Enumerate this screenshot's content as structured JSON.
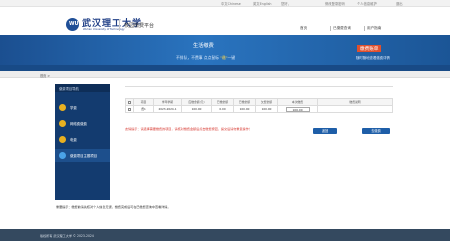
{
  "topbar": {
    "lang_zh": "中文Chinese",
    "lang_en": "英文English",
    "user": "您好，",
    "links": [
      "修改登录密码",
      "个人信息维护",
      "退出"
    ]
  },
  "header": {
    "logo_cn": "武汉理工大学",
    "logo_en": "Wuhan University of Technology",
    "site_name": "校园缴费平台",
    "nav": [
      "首页",
      "已缴费查询",
      "用户指南"
    ]
  },
  "banner": {
    "title": "生活缴费",
    "slogan_pre": "不排队，不费事",
    "slogan_mid": "点点鼠标 ",
    "slogan_hl": "\"缴\"",
    "slogan_post": "一键",
    "right_title": "缴费账单",
    "right_sub": "随时随地查看缴费详情"
  },
  "breadcrumb": "首页 >",
  "sidebar": {
    "title": "缴费项目导航",
    "items": [
      {
        "label": "学费",
        "icon": "yuan-icon",
        "color": "#e8b020"
      },
      {
        "label": "网络费缴费",
        "icon": "network-icon",
        "color": "#e8b020"
      },
      {
        "label": "电费",
        "icon": "bolt-icon",
        "color": "#e8b020"
      },
      {
        "label": "缴费项目主题项目",
        "icon": "list-icon",
        "color": "#4aa3e8",
        "active": true
      }
    ]
  },
  "table": {
    "headers": [
      "",
      "项目",
      "学年学期",
      "应缴金额(元)",
      "已缴金额",
      "已缴金额",
      "欠费金额",
      "本次缴费",
      "缴费说明"
    ],
    "rows": [
      {
        "checked": false,
        "project": "费1",
        "term": "2023-2024-1",
        "due": "100.00",
        "paid": "0.00",
        "arrears": "100.00",
        "amount": "100.00",
        "note": ""
      }
    ]
  },
  "warning": "友情提示：请选择需要缴费的项目，请核对缴费金额后点击缴费按钮，提交后请勿重复操作！",
  "buttons": {
    "back": "返回",
    "pay": "去缴费"
  },
  "notice": "重要提示：缴费前请先核对个人信息无误，缴费完成后可在已缴费查询中查看详情。",
  "footer": "版权所有 武汉理工大学 © 2023-2024"
}
